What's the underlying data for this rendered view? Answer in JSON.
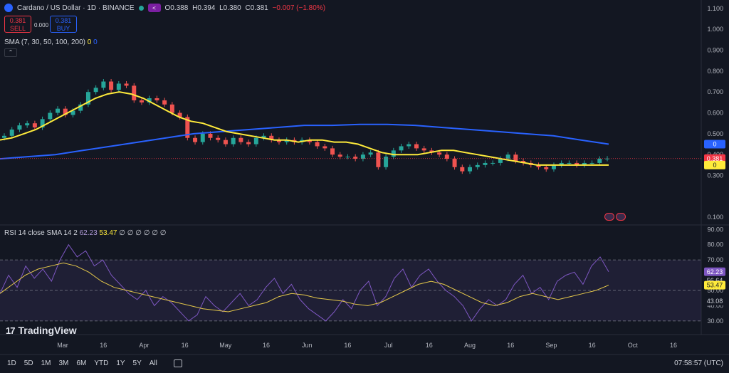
{
  "header": {
    "symbol": "Cardano / US Dollar · 1D · BINANCE",
    "open": "O0.388",
    "high": "H0.394",
    "low": "L0.380",
    "close": "C0.381",
    "change": "−0.007 (−1.80%)",
    "sell_price": "0.381",
    "sell_label": "SELL",
    "spread": "0.000",
    "buy_price": "0.381",
    "buy_label": "BUY"
  },
  "sma_legend": {
    "label": "SMA (7, 30, 50, 100, 200)",
    "v1": "0",
    "v2": "0"
  },
  "rsi_legend": {
    "label": "RSI 14 close SMA 14 2",
    "rsi": "62.23",
    "sma": "53.47",
    "rest": "∅ ∅ ∅ ∅ ∅ ∅"
  },
  "brand": "TradingView",
  "ranges": [
    "1D",
    "5D",
    "1M",
    "3M",
    "6M",
    "YTD",
    "1Y",
    "5Y",
    "All"
  ],
  "clock": "07:58:57 (UTC)",
  "colors": {
    "up": "#26a69a",
    "down": "#ef5350",
    "sma_yellow": "#ffeb3b",
    "sma_blue": "#2962ff",
    "rsi": "#7e57c2"
  },
  "chart_data": [
    {
      "type": "candlestick",
      "x_ticks": [
        "Mar",
        "16",
        "Apr",
        "16",
        "May",
        "16",
        "Jun",
        "16",
        "Jul",
        "16",
        "Aug",
        "16",
        "Sep",
        "16",
        "Oct",
        "16"
      ],
      "y_ticks": [
        "1.100",
        "1.000",
        "0.900",
        "0.800",
        "0.700",
        "0.600",
        "0.500",
        "0.400",
        "0.300",
        "0.100"
      ],
      "ylim": [
        0.07,
        1.12
      ],
      "close_series": [
        0.49,
        0.52,
        0.54,
        0.55,
        0.53,
        0.57,
        0.6,
        0.62,
        0.59,
        0.61,
        0.64,
        0.7,
        0.72,
        0.75,
        0.71,
        0.74,
        0.73,
        0.66,
        0.65,
        0.67,
        0.66,
        0.64,
        0.6,
        0.58,
        0.48,
        0.46,
        0.5,
        0.48,
        0.47,
        0.45,
        0.48,
        0.46,
        0.45,
        0.48,
        0.49,
        0.47,
        0.46,
        0.47,
        0.46,
        0.47,
        0.46,
        0.44,
        0.43,
        0.4,
        0.39,
        0.39,
        0.38,
        0.4,
        0.41,
        0.34,
        0.39,
        0.42,
        0.44,
        0.45,
        0.43,
        0.42,
        0.41,
        0.4,
        0.38,
        0.34,
        0.32,
        0.34,
        0.35,
        0.36,
        0.36,
        0.38,
        0.4,
        0.37,
        0.36,
        0.35,
        0.34,
        0.33,
        0.35,
        0.36,
        0.36,
        0.35,
        0.36,
        0.36,
        0.38,
        0.381
      ],
      "series": [
        {
          "name": "SMA yellow",
          "values": [
            0.47,
            0.48,
            0.5,
            0.52,
            0.55,
            0.58,
            0.61,
            0.64,
            0.67,
            0.69,
            0.7,
            0.69,
            0.67,
            0.64,
            0.61,
            0.58,
            0.56,
            0.55,
            0.53,
            0.51,
            0.5,
            0.49,
            0.48,
            0.47,
            0.47,
            0.46,
            0.47,
            0.47,
            0.46,
            0.46,
            0.45,
            0.43,
            0.41,
            0.4,
            0.4,
            0.4,
            0.41,
            0.42,
            0.42,
            0.41,
            0.4,
            0.39,
            0.38,
            0.37,
            0.36,
            0.35,
            0.35,
            0.35,
            0.35,
            0.35,
            0.35,
            0.35
          ]
        },
        {
          "name": "SMA blue",
          "values": [
            0.38,
            0.39,
            0.4,
            0.42,
            0.44,
            0.46,
            0.48,
            0.5,
            0.51,
            0.52,
            0.53,
            0.54,
            0.54,
            0.545,
            0.545,
            0.54,
            0.53,
            0.52,
            0.51,
            0.5,
            0.49,
            0.47,
            0.45
          ]
        }
      ],
      "price_labels": {
        "blue": "0",
        "last": "0.381",
        "yellow": "0"
      }
    },
    {
      "type": "line",
      "title": "RSI",
      "y_ticks": [
        "90.00",
        "80.00",
        "70.00",
        "60.00",
        "50.00",
        "40.00",
        "30.00"
      ],
      "ylim": [
        22,
        92
      ],
      "bands": [
        70,
        50,
        30
      ],
      "series": [
        {
          "name": "RSI",
          "values": [
            48,
            60,
            52,
            66,
            58,
            64,
            56,
            70,
            80,
            72,
            76,
            66,
            70,
            60,
            54,
            48,
            44,
            50,
            40,
            46,
            42,
            36,
            30,
            34,
            46,
            40,
            36,
            42,
            48,
            40,
            44,
            52,
            58,
            48,
            54,
            44,
            38,
            34,
            30,
            36,
            44,
            38,
            50,
            56,
            40,
            46,
            58,
            64,
            52,
            60,
            64,
            56,
            50,
            46,
            40,
            30,
            38,
            44,
            40,
            44,
            54,
            60,
            48,
            52,
            44,
            56,
            60,
            62,
            54,
            66,
            72,
            62.23
          ]
        },
        {
          "name": "SMA",
          "values": [
            48,
            54,
            60,
            64,
            66,
            68,
            66,
            62,
            56,
            52,
            50,
            48,
            46,
            44,
            42,
            40,
            38,
            37,
            36,
            38,
            40,
            42,
            46,
            48,
            47,
            45,
            44,
            43,
            41,
            40,
            42,
            46,
            50,
            54,
            56,
            54,
            50,
            46,
            42,
            40,
            42,
            46,
            48,
            46,
            44,
            46,
            48,
            50,
            53.47
          ]
        }
      ],
      "value_labels": [
        "62.23",
        "56.64",
        "53.47",
        "43.08"
      ]
    }
  ]
}
